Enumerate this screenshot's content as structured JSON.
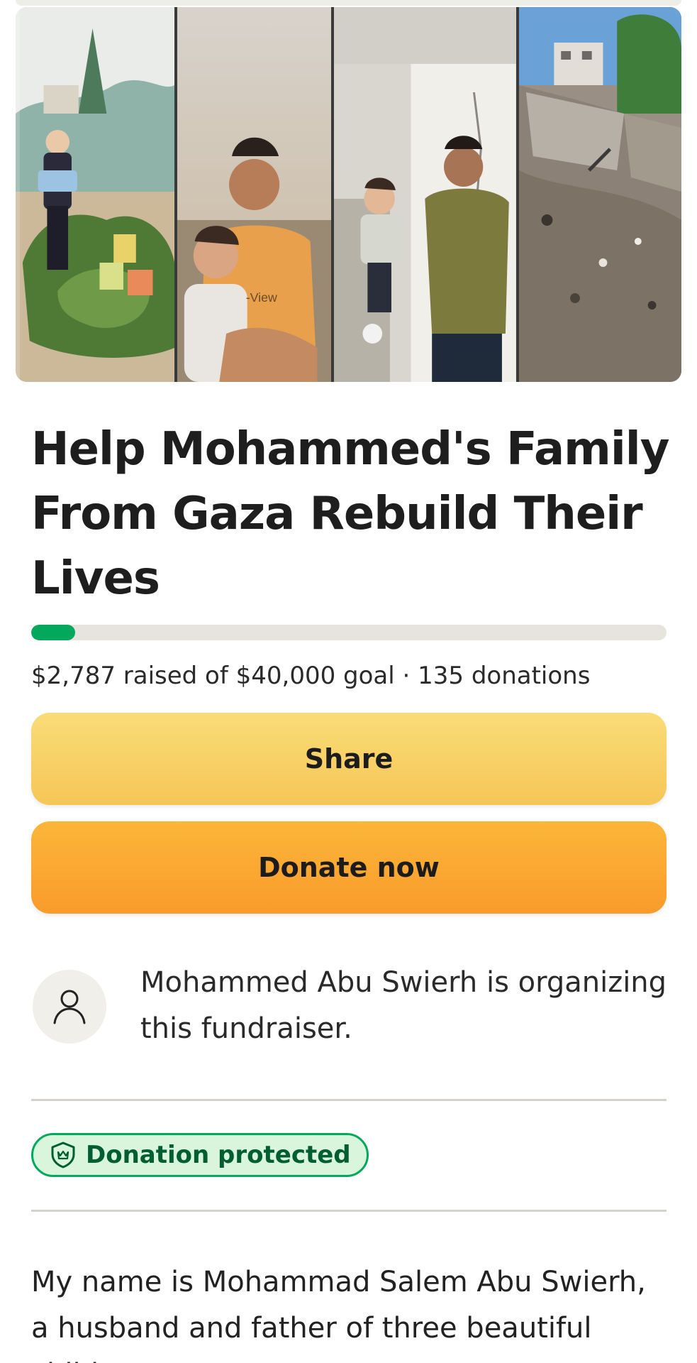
{
  "campaign": {
    "title": "Help Mohammed's Family From Gaza Rebuild Their Lives",
    "photo_caption": "-View"
  },
  "progress": {
    "raised_fraction": 0.0697,
    "stats_text": "$2,787 raised of $40,000 goal · 135 donations"
  },
  "actions": {
    "share_label": "Share",
    "donate_label": "Donate now"
  },
  "organizer": {
    "text": "Mohammed Abu Swierh is organizing this fundraiser.",
    "avatar_icon": "person-icon"
  },
  "protection": {
    "label": "Donation protected",
    "icon": "shield-icon"
  },
  "story": {
    "text": "My name is Mohammad Salem Abu Swierh, a husband and father of three beautiful children,"
  },
  "colors": {
    "progress_fill": "#02a95c",
    "progress_track": "#e6e4dc",
    "share_button": "#f6c656",
    "donate_button": "#f99b2c",
    "badge_border": "#02a95c",
    "badge_bg": "#d9f6dc",
    "badge_text": "#015d32"
  }
}
